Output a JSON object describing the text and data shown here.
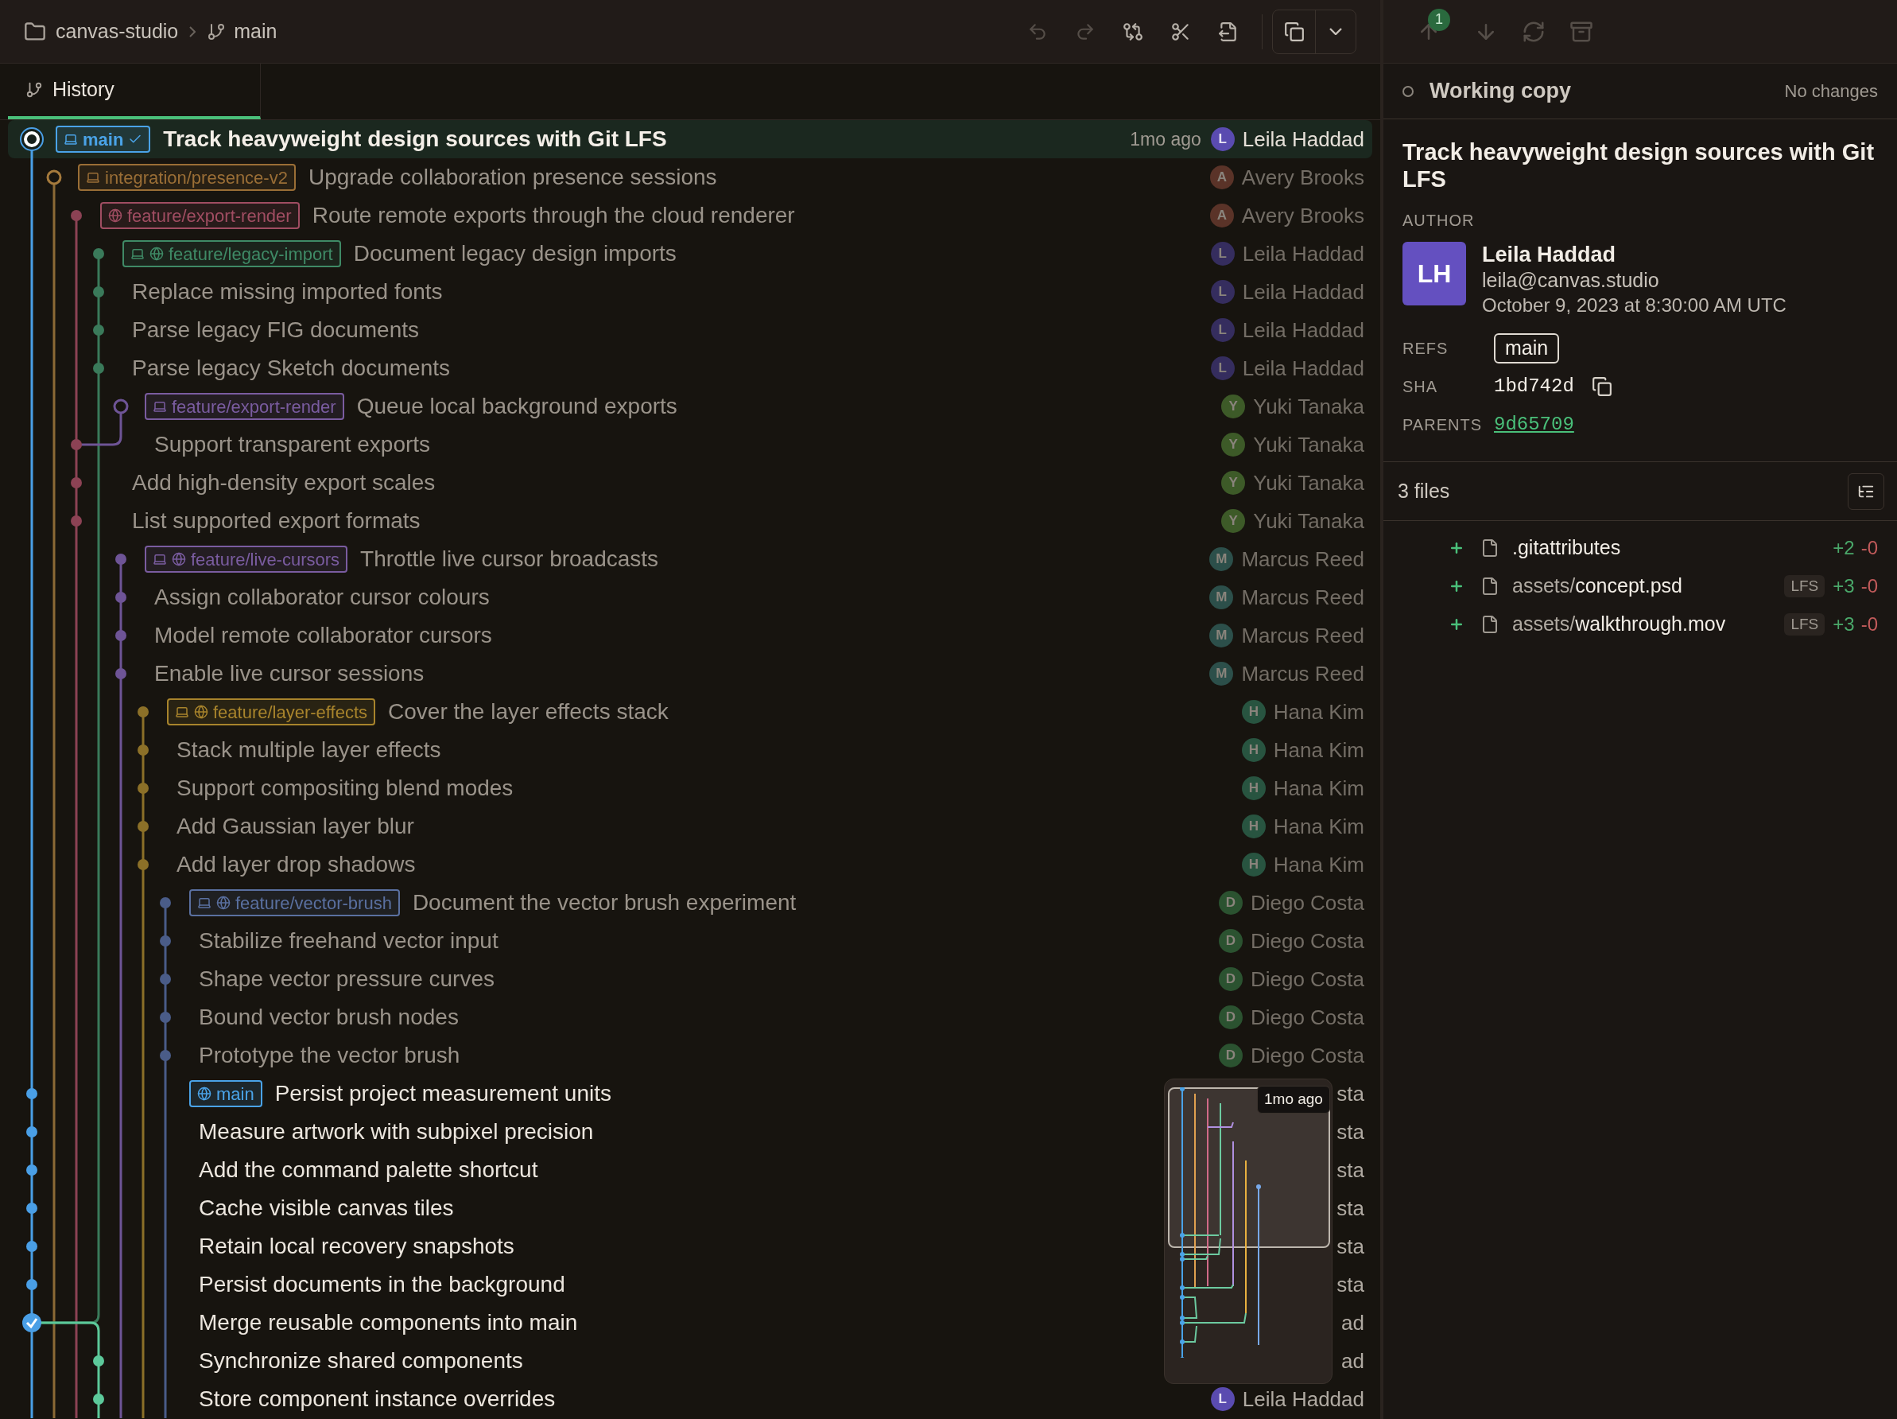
{
  "breadcrumb": {
    "repo": "canvas-studio",
    "branch": "main"
  },
  "toolbar": [
    {
      "kind": "undo",
      "disabled": true
    },
    {
      "kind": "redo",
      "disabled": true
    },
    {
      "kind": "compare",
      "disabled": false
    },
    {
      "kind": "cut",
      "disabled": false
    },
    {
      "kind": "export",
      "disabled": false
    }
  ],
  "sync": {
    "ahead": "1"
  },
  "tabs": [
    {
      "label": "History",
      "selected": true
    }
  ],
  "commits": [
    {
      "message": "Track heavyweight design sources with Git LFS",
      "selected": true,
      "dimmed": false,
      "time": "1mo ago",
      "author": "Leila Haddad",
      "initial": "L",
      "color": "#5a4bb0",
      "refs": [
        {
          "label": "main",
          "color": "#4aa3e8",
          "local": true,
          "remote": false,
          "head": true
        }
      ]
    },
    {
      "message": "Upgrade collaboration presence sessions",
      "selected": false,
      "dimmed": true,
      "author": "Avery Brooks",
      "initial": "A",
      "color": "#5a3328",
      "refs": [
        {
          "label": "integration/presence-v2",
          "color": "#9a6e36",
          "local": true,
          "remote": false,
          "head": false
        }
      ]
    },
    {
      "message": "Route remote exports through the cloud renderer",
      "selected": false,
      "dimmed": true,
      "author": "Avery Brooks",
      "initial": "A",
      "color": "#5a3328",
      "refs": [
        {
          "label": "feature/export-render",
          "color": "#a04d62",
          "local": false,
          "remote": true,
          "head": false
        }
      ]
    },
    {
      "message": "Document legacy design imports",
      "selected": false,
      "dimmed": true,
      "author": "Leila Haddad",
      "initial": "L",
      "color": "#352d5e",
      "refs": [
        {
          "label": "feature/legacy-import",
          "color": "#3f8a66",
          "local": true,
          "remote": true,
          "head": false
        }
      ]
    },
    {
      "message": "Replace missing imported fonts",
      "selected": false,
      "dimmed": true,
      "author": "Leila Haddad",
      "initial": "L",
      "color": "#352d5e"
    },
    {
      "message": "Parse legacy FIG documents",
      "selected": false,
      "dimmed": true,
      "author": "Leila Haddad",
      "initial": "L",
      "color": "#352d5e"
    },
    {
      "message": "Parse legacy Sketch documents",
      "selected": false,
      "dimmed": true,
      "author": "Leila Haddad",
      "initial": "L",
      "color": "#352d5e"
    },
    {
      "message": "Queue local background exports",
      "selected": false,
      "dimmed": true,
      "author": "Yuki Tanaka",
      "initial": "Y",
      "color": "#3d5a28",
      "refs": [
        {
          "label": "feature/export-render",
          "color": "#7a5ca0",
          "local": true,
          "remote": false,
          "head": false
        }
      ]
    },
    {
      "message": "Support transparent exports",
      "selected": false,
      "dimmed": true,
      "author": "Yuki Tanaka",
      "initial": "Y",
      "color": "#3d5a28"
    },
    {
      "message": "Add high-density export scales",
      "selected": false,
      "dimmed": true,
      "author": "Yuki Tanaka",
      "initial": "Y",
      "color": "#3d5a28"
    },
    {
      "message": "List supported export formats",
      "selected": false,
      "dimmed": true,
      "author": "Yuki Tanaka",
      "initial": "Y",
      "color": "#3d5a28"
    },
    {
      "message": "Throttle live cursor broadcasts",
      "selected": false,
      "dimmed": true,
      "author": "Marcus Reed",
      "initial": "M",
      "color": "#2c4f4a",
      "refs": [
        {
          "label": "feature/live-cursors",
          "color": "#7a5ca0",
          "local": true,
          "remote": true,
          "head": false
        }
      ]
    },
    {
      "message": "Assign collaborator cursor colours",
      "selected": false,
      "dimmed": true,
      "author": "Marcus Reed",
      "initial": "M",
      "color": "#2c4f4a"
    },
    {
      "message": "Model remote collaborator cursors",
      "selected": false,
      "dimmed": true,
      "author": "Marcus Reed",
      "initial": "M",
      "color": "#2c4f4a"
    },
    {
      "message": "Enable live cursor sessions",
      "selected": false,
      "dimmed": true,
      "author": "Marcus Reed",
      "initial": "M",
      "color": "#2c4f4a"
    },
    {
      "message": "Cover the layer effects stack",
      "selected": false,
      "dimmed": true,
      "author": "Hana Kim",
      "initial": "H",
      "color": "#285440",
      "refs": [
        {
          "label": "feature/layer-effects",
          "color": "#a8842c",
          "local": true,
          "remote": true,
          "head": false
        }
      ]
    },
    {
      "message": "Stack multiple layer effects",
      "selected": false,
      "dimmed": true,
      "author": "Hana Kim",
      "initial": "H",
      "color": "#285440"
    },
    {
      "message": "Support compositing blend modes",
      "selected": false,
      "dimmed": true,
      "author": "Hana Kim",
      "initial": "H",
      "color": "#285440"
    },
    {
      "message": "Add Gaussian layer blur",
      "selected": false,
      "dimmed": true,
      "author": "Hana Kim",
      "initial": "H",
      "color": "#285440"
    },
    {
      "message": "Add layer drop shadows",
      "selected": false,
      "dimmed": true,
      "author": "Hana Kim",
      "initial": "H",
      "color": "#285440"
    },
    {
      "message": "Document the vector brush experiment",
      "selected": false,
      "dimmed": true,
      "author": "Diego Costa",
      "initial": "D",
      "color": "#2b5230",
      "refs": [
        {
          "label": "feature/vector-brush",
          "color": "#5a70a0",
          "local": true,
          "remote": true,
          "head": false
        }
      ]
    },
    {
      "message": "Stabilize freehand vector input",
      "selected": false,
      "dimmed": true,
      "author": "Diego Costa",
      "initial": "D",
      "color": "#2b5230"
    },
    {
      "message": "Shape vector pressure curves",
      "selected": false,
      "dimmed": true,
      "author": "Diego Costa",
      "initial": "D",
      "color": "#2b5230"
    },
    {
      "message": "Bound vector brush nodes",
      "selected": false,
      "dimmed": true,
      "author": "Diego Costa",
      "initial": "D",
      "color": "#2b5230"
    },
    {
      "message": "Prototype the vector brush",
      "selected": false,
      "dimmed": true,
      "author": "Diego Costa",
      "initial": "D",
      "color": "#2b5230"
    },
    {
      "message": "Persist project measurement units",
      "selected": false,
      "dimmed": false,
      "author": "sta",
      "refs": [
        {
          "label": "main",
          "color": "#4aa3e8",
          "local": false,
          "remote": true,
          "head": false
        }
      ]
    },
    {
      "message": "Measure artwork with subpixel precision",
      "selected": false,
      "dimmed": false,
      "author": "sta"
    },
    {
      "message": "Add the command palette shortcut",
      "selected": false,
      "dimmed": false,
      "author": "sta"
    },
    {
      "message": "Cache visible canvas tiles",
      "selected": false,
      "dimmed": false,
      "author": "sta"
    },
    {
      "message": "Retain local recovery snapshots",
      "selected": false,
      "dimmed": false,
      "author": "sta"
    },
    {
      "message": "Persist documents in the background",
      "selected": false,
      "dimmed": false,
      "author": "sta"
    },
    {
      "message": "Merge reusable components into main",
      "selected": false,
      "dimmed": false,
      "author": "ad"
    },
    {
      "message": "Synchronize shared components",
      "selected": false,
      "dimmed": false,
      "author": "ad"
    },
    {
      "message": "Store component instance overrides",
      "selected": false,
      "dimmed": false,
      "author": "Leila Haddad",
      "initial": "L",
      "color": "#5a4bb0"
    }
  ],
  "minimap": {
    "tooltip": "1mo ago"
  },
  "working_copy": {
    "label": "Working copy",
    "status": "No changes"
  },
  "details": {
    "title": "Track heavyweight design sources with Git LFS",
    "author_label": "AUTHOR",
    "initials": "LH",
    "name": "Leila Haddad",
    "email": "leila@canvas.studio",
    "date": "October 9, 2023 at 8:30:00 AM UTC",
    "refs_label": "REFS",
    "ref": "main",
    "sha_label": "SHA",
    "sha": "1bd742d",
    "parents_label": "PARENTS",
    "parent": "9d65709"
  },
  "files": {
    "count": "3 files",
    "items": [
      {
        "name": ".gitattributes",
        "added": "+2",
        "removed": "-0"
      },
      {
        "dir": "assets/",
        "name": "concept.psd",
        "badge": "LFS",
        "added": "+3",
        "removed": "-0"
      },
      {
        "dir": "assets/",
        "name": "walkthrough.mov",
        "badge": "LFS",
        "added": "+3",
        "removed": "-0"
      }
    ]
  }
}
